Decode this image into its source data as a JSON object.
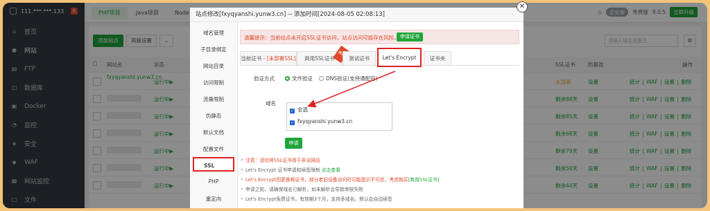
{
  "sidebar": {
    "ip": "111.***.***.133",
    "badge": "0",
    "items": [
      {
        "icon": "⌂",
        "label": "首页"
      },
      {
        "icon": "●",
        "label": "网站"
      },
      {
        "icon": "▤",
        "label": "FTP"
      },
      {
        "icon": "◫",
        "label": "数据库"
      },
      {
        "icon": "▣",
        "label": "Docker"
      },
      {
        "icon": "◔",
        "label": "监控"
      },
      {
        "icon": "◈",
        "label": "安全"
      },
      {
        "icon": "◆",
        "label": "WAF"
      },
      {
        "icon": "▦",
        "label": "网站监控"
      },
      {
        "icon": "▢",
        "label": "文件"
      }
    ]
  },
  "topbar": {
    "tabs": [
      "PHP项目",
      "Java项目",
      "Node"
    ],
    "enterprise": "企业版",
    "free_label": "免费版",
    "version": "8.0.5",
    "upgrade": "立即升级"
  },
  "main": {
    "add_site": "添加站点",
    "advanced": "高级设置",
    "search_placeholder": "请输入域名或备注",
    "columns": {
      "name": "网站名",
      "status": "状态",
      "ssl": "SSL证书",
      "protect": "防篡改",
      "ops": "操作"
    },
    "rows": [
      {
        "name": "fxyqyanshi.yunw3.cn",
        "status": "运行中▶",
        "ssl": "未部署",
        "protect": "设置",
        "ops": "统计 | WAF | 设置 | 删除"
      },
      {
        "name": "",
        "status": "运行中▶",
        "ssl": "剩余88天",
        "protect": "设置",
        "ops": "统计 | WAF | 设置 | 删除"
      },
      {
        "name": "",
        "status": "运行中▶",
        "ssl": "剩余85天",
        "protect": "设置",
        "ops": "统计 | WAF | 设置 | 删除"
      },
      {
        "name": "",
        "status": "运行中▶",
        "ssl": "剩余68天",
        "protect": "设置",
        "ops": "统计 | WAF | 设置 | 删除"
      },
      {
        "name": "",
        "status": "运行中▶",
        "ssl": "剩余79天",
        "protect": "设置",
        "ops": "统计 | WAF | 设置 | 删除"
      },
      {
        "name": "",
        "status": "运行中▶",
        "ssl": "剩余50天",
        "protect": "设置",
        "ops": "统计 | WAF | 设置 | 删除"
      },
      {
        "name": "",
        "status": "运行中▶",
        "ssl": "剩余44天",
        "protect": "设置",
        "ops": "统计 | WAF | 设置 | 删除"
      }
    ]
  },
  "dialog": {
    "title": "站点修改[fxyqyanshi.yunw3.cn] -- 添加时间[2024-08-05 02:08:13]",
    "menu": [
      "域名管理",
      "子目录绑定",
      "网站目录",
      "访问限制",
      "流量限制",
      "伪静态",
      "默认文档",
      "配置文件",
      "SSL",
      "PHP",
      "重定向"
    ],
    "alert_text": "温馨提示：当前站点未开启SSL证书访问，站点访问可能存在风险。",
    "alert_button": "申请证书",
    "tabs": {
      "current": "当前证书 - ",
      "current_red": "[未部署SSL]",
      "commercial": "商用SSL证书",
      "test": "测试证书",
      "letsencrypt": "Let's Encrypt",
      "folder": "证书夹",
      "ribbon": "推荐"
    },
    "verify_label": "验证方式",
    "verify_file": "文件验证",
    "verify_dns": "DNS验证(支持通配符)",
    "domain_label": "域名",
    "select_all": "全选",
    "domain": "fxyqyanshi.yunw3.cn",
    "apply": "申请",
    "notes": {
      "n1_a": "注意：请勿将SSL证书用于非法网站",
      "n2_a": "Let's Encrypt 证书申请和续签限制 ",
      "n2_b": "点击查看",
      "n3_a": "Let's Encrypt因更换根证书，部分老旧设备访问时可能提示不可信，考虑购买",
      "n3_b": "[商用SSL证书]",
      "n4": "申请之前，请确保域名已解析，如未解析会导致审核失败",
      "n5": "Let's Encrypt免费证书，有效期3个月，支持多域名。默认会自动续签"
    }
  },
  "colors": {
    "accent": "#20a53a",
    "danger": "#e02020",
    "frame": "#f3c37a"
  }
}
